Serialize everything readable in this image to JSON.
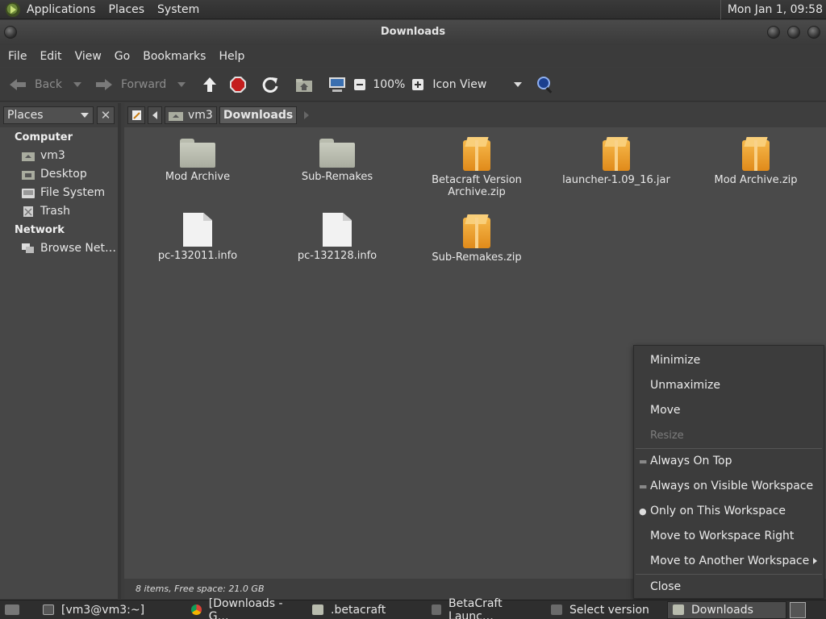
{
  "top_panel": {
    "menus": [
      "Applications",
      "Places",
      "System"
    ],
    "clock": "Mon Jan  1, 09:58"
  },
  "window": {
    "title": "Downloads"
  },
  "menubar": [
    "File",
    "Edit",
    "View",
    "Go",
    "Bookmarks",
    "Help"
  ],
  "toolbar": {
    "back": "Back",
    "forward": "Forward",
    "zoom": "100%",
    "view_mode": "Icon View"
  },
  "sidebar": {
    "selector": "Places",
    "groups": [
      {
        "title": "Computer",
        "items": [
          "vm3",
          "Desktop",
          "File System",
          "Trash"
        ]
      },
      {
        "title": "Network",
        "items": [
          "Browse Net…"
        ]
      }
    ]
  },
  "pathbar": {
    "segments": [
      "vm3",
      "Downloads"
    ]
  },
  "files": [
    {
      "name": "Mod Archive",
      "name2": "",
      "type": "folder"
    },
    {
      "name": "Sub-Remakes",
      "name2": "",
      "type": "folder"
    },
    {
      "name": "Betacraft Version",
      "name2": "Archive.zip",
      "type": "archive"
    },
    {
      "name": "launcher-1.09_16.jar",
      "name2": "",
      "type": "archive"
    },
    {
      "name": "Mod Archive.zip",
      "name2": "",
      "type": "archive"
    },
    {
      "name": "pc-132011.info",
      "name2": "",
      "type": "document"
    },
    {
      "name": "pc-132128.info",
      "name2": "",
      "type": "document"
    },
    {
      "name": "Sub-Remakes.zip",
      "name2": "",
      "type": "archive"
    }
  ],
  "status": "8 items, Free space: 21.0 GB",
  "context_menu": {
    "items": [
      "Minimize",
      "Unmaximize",
      "Move",
      "Resize"
    ],
    "workspace_items": [
      "Always On Top",
      "Always on Visible Workspace",
      "Only on This Workspace",
      "Move to Workspace Right",
      "Move to Another Workspace"
    ],
    "close": "Close"
  },
  "taskbar": [
    "[vm3@vm3:~]",
    "[Downloads - G…",
    ".betacraft",
    "BetaCraft Launc…",
    "Select version",
    "Downloads"
  ]
}
